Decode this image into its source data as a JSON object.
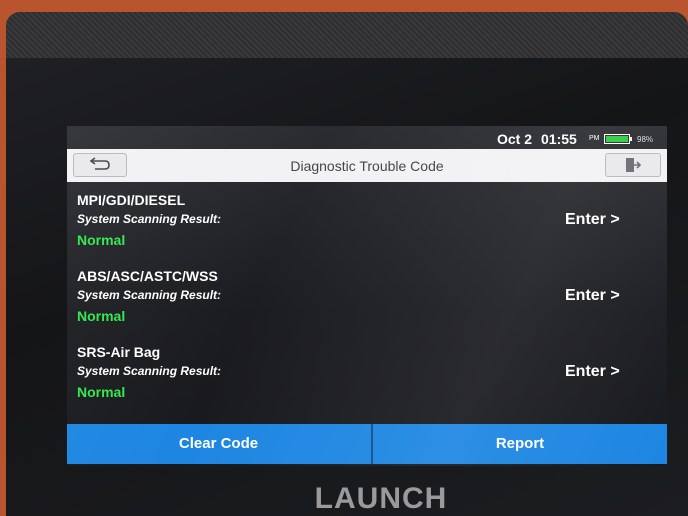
{
  "colors": {
    "accent": "#1d86e2",
    "status_normal": "#2ee84a",
    "title_bar": "#f2f2f4",
    "device_frame": "#b8552e"
  },
  "device": {
    "brand": "LAUNCH"
  },
  "status_bar": {
    "date": "Oct 2",
    "time": "01:55",
    "ampm": "PM",
    "battery_percent": "98%",
    "battery_level": 0.98
  },
  "title_bar": {
    "title": "Diagnostic Trouble Code",
    "back_icon": "back-arrow-icon",
    "exit_icon": "exit-door-icon"
  },
  "systems": [
    {
      "name": "MPI/GDI/DIESEL",
      "label": "System Scanning Result:",
      "status": "Normal",
      "action": "Enter >"
    },
    {
      "name": "ABS/ASC/ASTC/WSS",
      "label": "System Scanning Result:",
      "status": "Normal",
      "action": "Enter >"
    },
    {
      "name": "SRS-Air Bag",
      "label": "System Scanning Result:",
      "status": "Normal",
      "action": "Enter >"
    }
  ],
  "footer": {
    "clear_code": "Clear Code",
    "report": "Report"
  }
}
